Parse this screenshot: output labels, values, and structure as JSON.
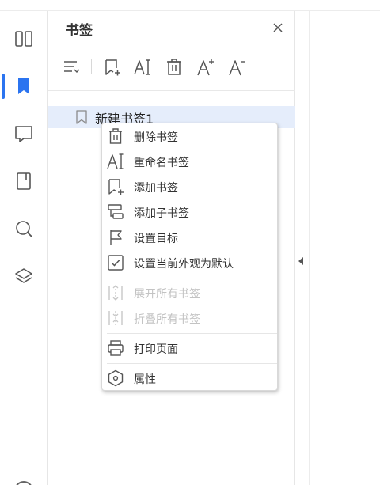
{
  "panel": {
    "title": "书签",
    "close_icon": "close-icon"
  },
  "rail": {
    "items": [
      {
        "name": "thumbnail-icon",
        "active": false
      },
      {
        "name": "bookmark-icon",
        "active": true
      },
      {
        "name": "comment-icon",
        "active": false
      },
      {
        "name": "attachment-icon",
        "active": false
      },
      {
        "name": "search-icon",
        "active": false
      },
      {
        "name": "layers-icon",
        "active": false
      }
    ]
  },
  "toolbar": {
    "icons": [
      "expand-collapse-icon",
      "add-bookmark-icon",
      "rename-icon",
      "delete-icon",
      "increase-font-icon",
      "decrease-font-icon"
    ]
  },
  "bookmark": {
    "label": "新建书签1"
  },
  "menu": {
    "items": [
      {
        "label": "删除书签",
        "icon": "delete-icon",
        "disabled": false
      },
      {
        "label": "重命名书签",
        "icon": "rename-icon",
        "disabled": false
      },
      {
        "label": "添加书签",
        "icon": "add-bookmark-icon",
        "disabled": false
      },
      {
        "label": "添加子书签",
        "icon": "add-child-bookmark-icon",
        "disabled": false
      },
      {
        "label": "设置目标",
        "icon": "flag-icon",
        "disabled": false
      },
      {
        "label": "设置当前外观为默认",
        "icon": "checkbox-icon",
        "disabled": false
      },
      {
        "label": "展开所有书签",
        "icon": "expand-all-icon",
        "disabled": true
      },
      {
        "label": "折叠所有书签",
        "icon": "collapse-all-icon",
        "disabled": true
      },
      {
        "label": "打印页面",
        "icon": "print-icon",
        "disabled": false
      },
      {
        "label": "属性",
        "icon": "properties-icon",
        "disabled": false
      }
    ]
  },
  "colors": {
    "accent": "#2b74f0",
    "selected_row": "#e5edfb",
    "icon": "#555555",
    "disabled": "#c3c3c3"
  }
}
